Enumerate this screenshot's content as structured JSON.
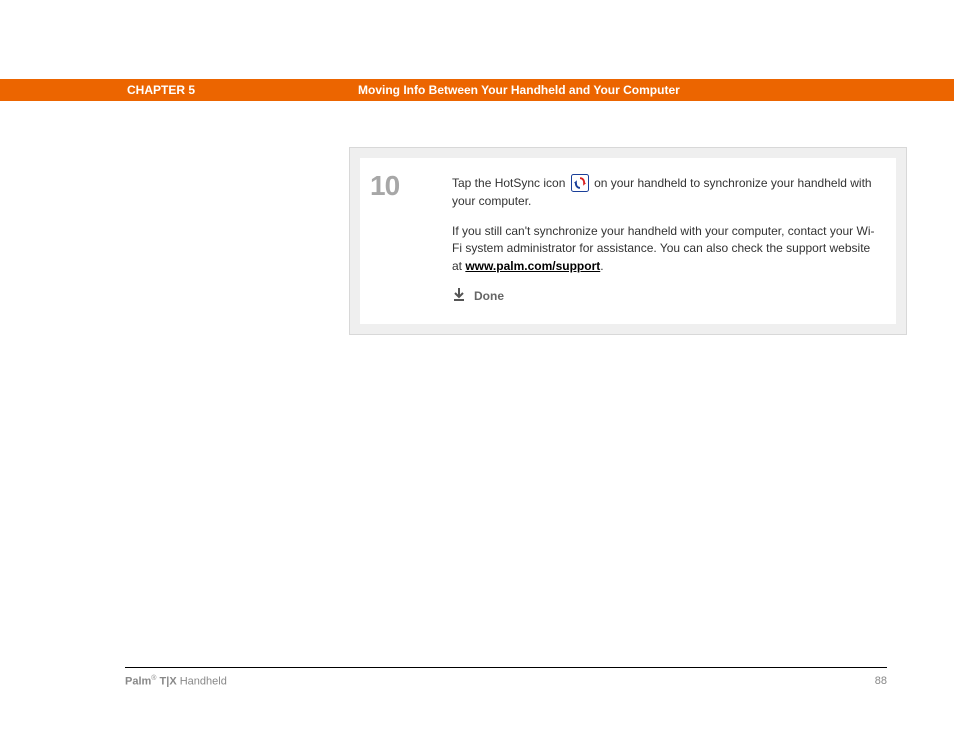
{
  "header": {
    "chapter": "CHAPTER 5",
    "title": "Moving Info Between Your Handheld and Your Computer"
  },
  "step": {
    "number": "10",
    "line1_a": "Tap the HotSync icon ",
    "line1_b": " on your handheld to synchronize your handheld with your computer.",
    "line2_a": "If you still can't synchronize your handheld with your computer, contact your Wi-Fi system administrator for assistance. You can also check the support website at ",
    "support_link": "www.palm.com/support",
    "line2_b": ".",
    "done": "Done"
  },
  "footer": {
    "brand_bold": "Palm",
    "brand_reg": "®",
    "brand_model": " T|X",
    "brand_rest": " Handheld",
    "page": "88"
  }
}
